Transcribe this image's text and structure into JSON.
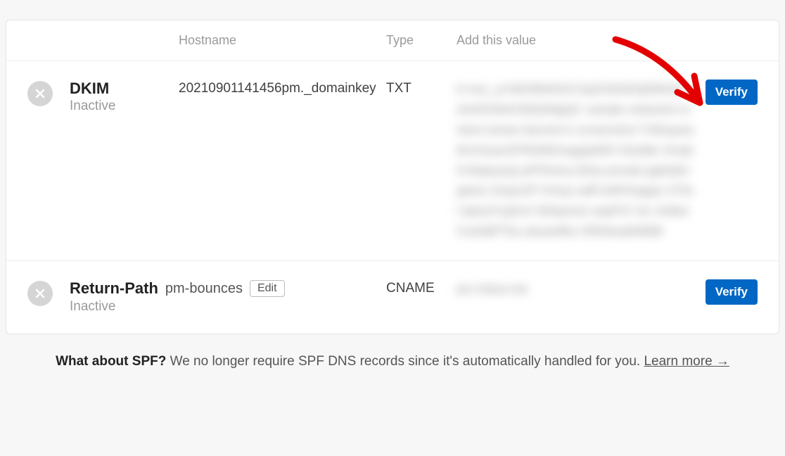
{
  "headers": {
    "hostname": "Hostname",
    "type": "Type",
    "value": "Add this value"
  },
  "records": {
    "dkim": {
      "name": "DKIM",
      "status": "Inactive",
      "hostname": "20210901141456pm._domainkey",
      "type": "TXT",
      "value_redacted": "k=rsa;_p=MIGfMA0GCSqGSIb3DQEBAQUAA4GNADCBiQKBgQC xample redacted content shown blurred in screenshot TnRequestKmGaseSFRtIABrinagqaMW Cboldkc Ihnqh5YBabasQLaPPfmhra lEfoLsimo8LngMxBHgaixtc DoqmZP Hmsp salff ahMYeqppo STfal IptioxF1pEsX 6Dlqomei oaqPSY bn JmBarCraGBPTbu akoas86o ORK8uat56888",
      "verify_label": "Verify"
    },
    "return_path": {
      "name": "Return-Path",
      "status": "Inactive",
      "hostname": "pm-bounces",
      "edit_label": "Edit",
      "type": "CNAME",
      "value_redacted": "pm.mtasv.net",
      "verify_label": "Verify"
    }
  },
  "footer": {
    "lead": "What about SPF?",
    "body": "We no longer require SPF DNS records since it's automatically handled for you.",
    "link": "Learn more →"
  }
}
